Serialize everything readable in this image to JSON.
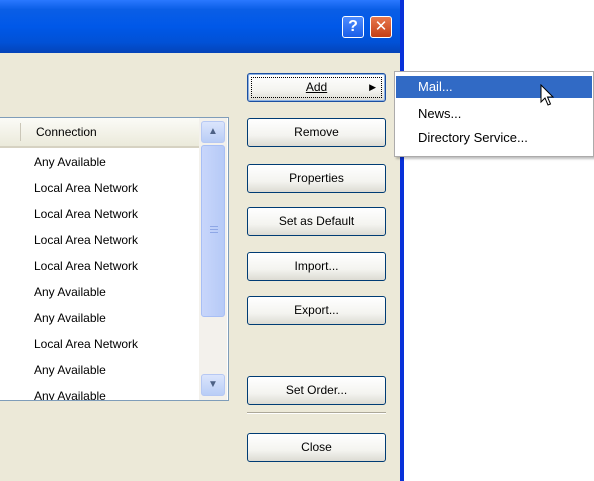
{
  "window": {
    "help_button": "?",
    "close_button": "✕"
  },
  "accounts_list": {
    "column_header": "Connection",
    "rows": [
      "Any Available",
      "Local Area Network",
      "Local Area Network",
      "Local Area Network",
      "Local Area Network",
      "Any Available",
      "Any Available",
      "Local Area Network",
      "Any Available",
      "Any Available"
    ]
  },
  "buttons": {
    "add": "Add",
    "remove": "Remove",
    "properties": "Properties",
    "set_default": "Set as Default",
    "import": "Import...",
    "export": "Export...",
    "set_order": "Set Order...",
    "close": "Close"
  },
  "add_menu": {
    "items": [
      "Mail...",
      "News...",
      "Directory Service..."
    ]
  },
  "colors": {
    "title_bar": "#0058e8",
    "menu_highlight": "#316ac5",
    "dialog_face": "#ece9d8"
  },
  "icons": [
    "help-icon",
    "close-icon",
    "scroll-up-icon",
    "scroll-down-icon",
    "submenu-arrow-icon",
    "mouse-cursor-icon"
  ]
}
